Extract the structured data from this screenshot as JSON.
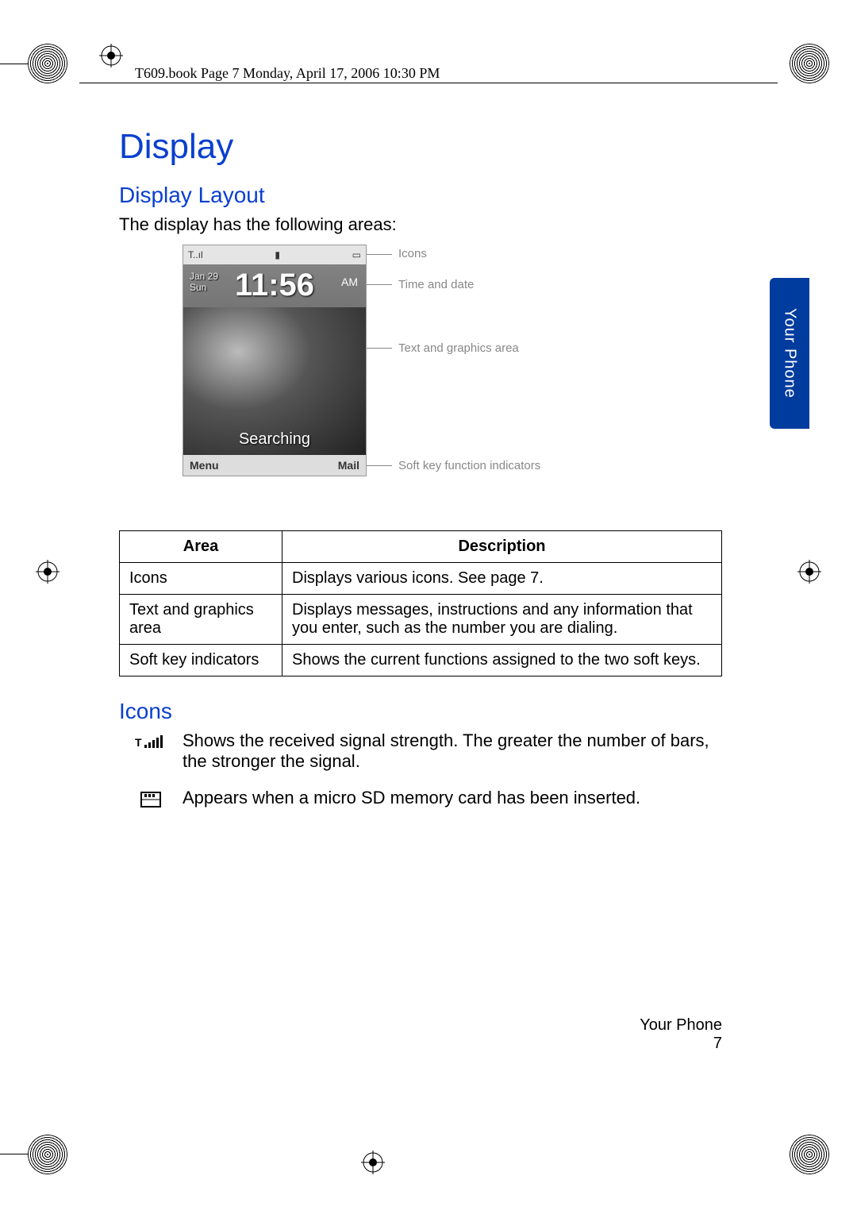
{
  "header": "T609.book  Page 7  Monday, April 17, 2006  10:30 PM",
  "title": "Display",
  "section1": {
    "heading": "Display Layout",
    "intro": "The display has the following areas:"
  },
  "diagram": {
    "iconbar_left": "T..ıl",
    "iconbar_right": "▭",
    "iconbar_mid": "▮",
    "date_line1": "Jan 29",
    "date_line2": "Sun",
    "clock": "11:56",
    "ampm": "AM",
    "searching": "Searching",
    "soft_left": "Menu",
    "soft_right": "Mail",
    "callouts": {
      "icons": "Icons",
      "time": "Time and date",
      "text": "Text and graphics area",
      "soft": "Soft key function indicators"
    }
  },
  "side_tab": "Your Phone",
  "table": {
    "h1": "Area",
    "h2": "Description",
    "rows": [
      {
        "area": "Icons",
        "desc": "Displays various icons. See page 7."
      },
      {
        "area": "Text and graphics area",
        "desc": "Displays messages, instructions and any information that you enter, such as the number you are dialing."
      },
      {
        "area": "Soft key indicators",
        "desc": "Shows the current functions assigned to the two soft keys."
      }
    ]
  },
  "section2": {
    "heading": "Icons",
    "items": [
      {
        "icon_name": "signal-strength-icon",
        "glyph": "T..ıl",
        "desc": "Shows the received signal strength. The greater the number of bars, the stronger the signal."
      },
      {
        "icon_name": "sd-card-icon",
        "glyph": "⧈",
        "desc": "Appears when a micro SD memory card has been inserted."
      }
    ]
  },
  "footer": {
    "section": "Your Phone",
    "page": "7"
  }
}
